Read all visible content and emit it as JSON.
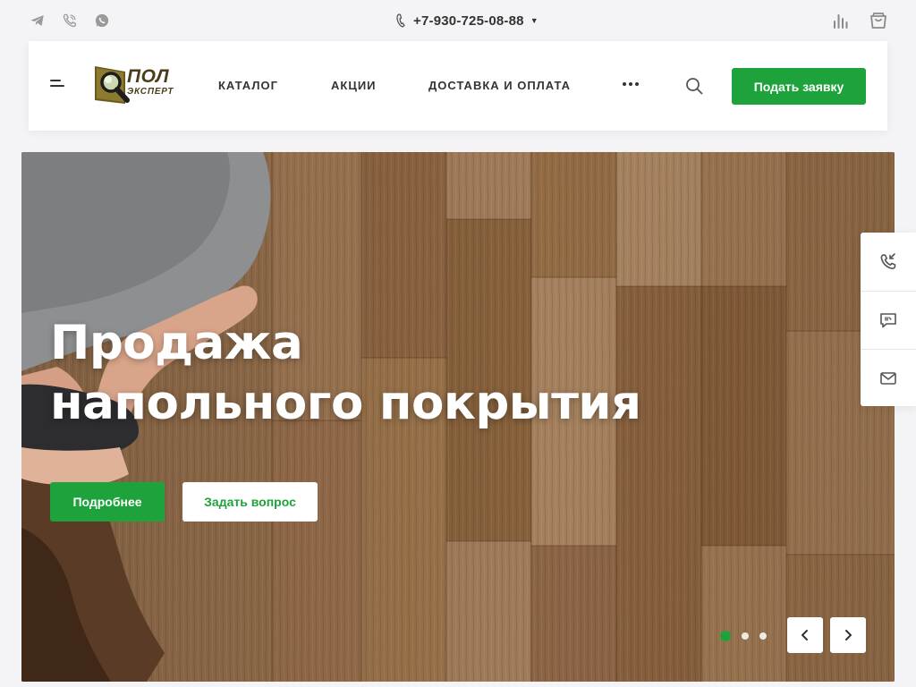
{
  "topbar": {
    "social": [
      "telegram-icon",
      "viber-icon",
      "whatsapp-icon"
    ],
    "phone": "+7-930-725-08-88",
    "right_icons": [
      "compare-icon",
      "cart-icon"
    ]
  },
  "header": {
    "logo": {
      "title": "ПОЛ",
      "subtitle": "ЭКСПЕРТ"
    },
    "nav": [
      {
        "label": "КАТАЛОГ"
      },
      {
        "label": "АКЦИИ"
      },
      {
        "label": "ДОСТАВКА И ОПЛАТА"
      }
    ],
    "cta_label": "Подать заявку"
  },
  "hero": {
    "title_line1": "Продажа",
    "title_line2": "напольного покрытия",
    "btn_more": "Подробнее",
    "btn_ask": "Задать вопрос",
    "slides_total": 3,
    "active_slide": 1
  },
  "side_widget": [
    "callback-icon",
    "chat-icon",
    "mail-icon"
  ],
  "colors": {
    "accent": "#1ea33c",
    "text": "#333333",
    "bg": "#f4f4f6"
  }
}
